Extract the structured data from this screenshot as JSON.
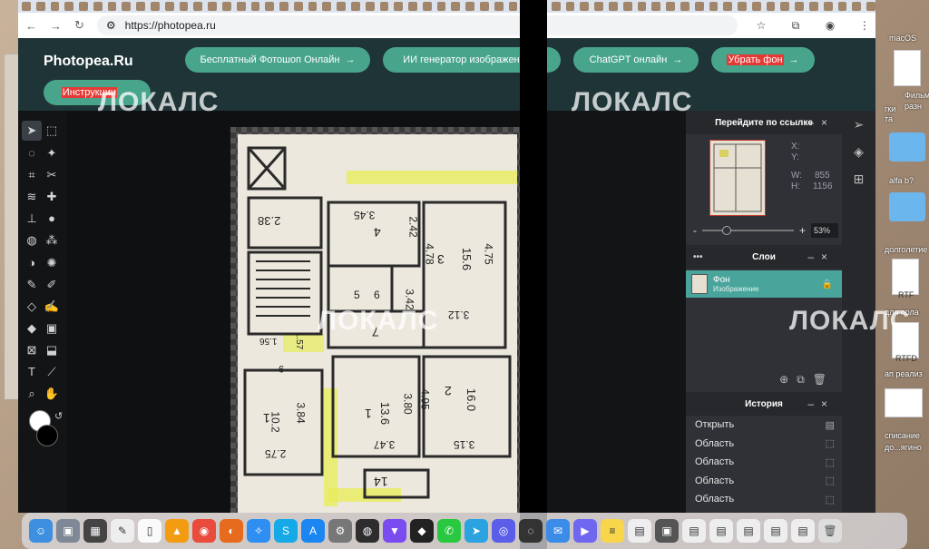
{
  "browser": {
    "url": "https://photopea.ru"
  },
  "header": {
    "logo": "Photopea.Ru",
    "pills": [
      {
        "label": "Бесплатный Фотошоп Онлайн",
        "arrow": "→"
      },
      {
        "label": "ИИ генератор изображени",
        "arrow": "→"
      },
      {
        "label": "ChatGPT онлайн",
        "arrow": "→"
      },
      {
        "label": "Убрать фон",
        "arrow": "→"
      },
      {
        "label": "Инструкции",
        "arrow": "→"
      }
    ]
  },
  "navigator": {
    "title": "Перейдите по ссылке",
    "x_label": "X:",
    "y_label": "Y:",
    "w_label": "W:",
    "w_value": "855",
    "h_label": "H:",
    "h_value": "1156",
    "zoom_minus": "-",
    "zoom_plus": "+",
    "zoom_value": "53%"
  },
  "layers": {
    "title": "Слои",
    "items": [
      {
        "name": "Фон",
        "sub": "Изображение"
      }
    ]
  },
  "history": {
    "title": "История",
    "items": [
      "Открыть",
      "Область",
      "Область",
      "Область",
      "Область"
    ]
  },
  "watermarks": [
    "ЛОКАЛС",
    "ЛОКАЛС",
    "ЛОКАЛС",
    "ЛОКАЛС"
  ],
  "desktop": {
    "labels": [
      "macOS",
      "Фильм",
      "разн",
      "гки",
      "та",
      "alfa b?",
      "долголетие",
      "RTF",
      "для пола",
      "RTFD",
      "ап реализ",
      "списание",
      "до...ягино"
    ]
  },
  "plan_labels": [
    "2.38",
    "3.45",
    "4",
    "2.42",
    "3",
    "4.78",
    "15.6",
    "4.75",
    "7",
    "3.42",
    "3.12",
    "5",
    "6",
    "1.56",
    "1.57",
    "4.95",
    "2",
    "16.0",
    "1",
    "13.6",
    "3.80",
    "3.47",
    "3.15",
    "1",
    "10.2",
    "3.84",
    "2.75",
    "14",
    "9"
  ]
}
